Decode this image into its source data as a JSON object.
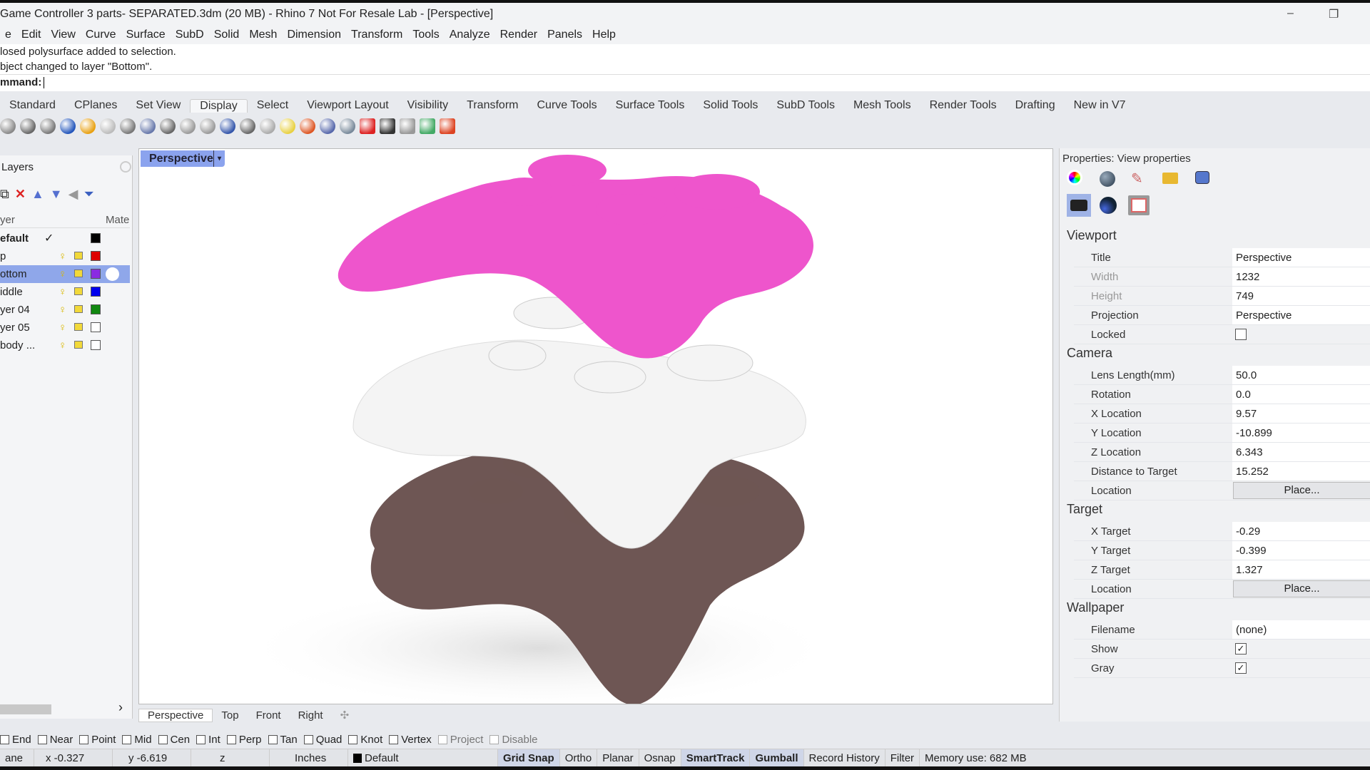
{
  "window": {
    "title": "Game Controller 3 parts- SEPARATED.3dm (20 MB) - Rhino 7 Not For Resale Lab - [Perspective]",
    "minimize": "–",
    "restore": "❐"
  },
  "menu": [
    "e",
    "Edit",
    "View",
    "Curve",
    "Surface",
    "SubD",
    "Solid",
    "Mesh",
    "Dimension",
    "Transform",
    "Tools",
    "Analyze",
    "Render",
    "Panels",
    "Help"
  ],
  "command": {
    "history": [
      "losed polysurface added to selection.",
      "bject changed to layer \"Bottom\"."
    ],
    "prompt": "mmand:",
    "value": ""
  },
  "toolbar_tabs": {
    "items": [
      "Standard",
      "CPlanes",
      "Set View",
      "Display",
      "Select",
      "Viewport Layout",
      "Visibility",
      "Transform",
      "Curve Tools",
      "Surface Tools",
      "Solid Tools",
      "SubD Tools",
      "Mesh Tools",
      "Render Tools",
      "Drafting",
      "New in V7"
    ],
    "active": "Display"
  },
  "layers": {
    "title": "Layers",
    "col_layer": "yer",
    "col_material": "Mate",
    "rows": [
      {
        "name": "efault",
        "current": true,
        "color": "#000000"
      },
      {
        "name": "p",
        "color": "#dd0000"
      },
      {
        "name": "ottom",
        "selected": true,
        "color": "#8a2be2"
      },
      {
        "name": "iddle",
        "color": "#0000ee"
      },
      {
        "name": "yer 04",
        "color": "#118811"
      },
      {
        "name": "yer 05",
        "color": "#ffffff"
      },
      {
        "name": "body ...",
        "color": "#ffffff"
      }
    ],
    "current_mark": "✓",
    "scroll_right": "›"
  },
  "viewport": {
    "title": "Perspective",
    "dropdown": "▾",
    "colors": {
      "top": "#ee55cc",
      "middle": "#f4f4f4",
      "bottom": "#6e5654"
    }
  },
  "viewport_tabs": {
    "items": [
      "Perspective",
      "Top",
      "Front",
      "Right"
    ],
    "active": "Perspective",
    "add": "✣"
  },
  "properties": {
    "title": "Properties: View properties",
    "sections": [
      {
        "name": "Viewport",
        "rows": [
          {
            "label": "Title",
            "value": "Perspective"
          },
          {
            "label": "Width",
            "value": "1232",
            "dim": true
          },
          {
            "label": "Height",
            "value": "749",
            "dim": true
          },
          {
            "label": "Projection",
            "value": "Perspective"
          },
          {
            "label": "Locked",
            "checkbox": false
          }
        ]
      },
      {
        "name": "Camera",
        "rows": [
          {
            "label": "Lens Length(mm)",
            "value": "50.0"
          },
          {
            "label": "Rotation",
            "value": "0.0"
          },
          {
            "label": "X Location",
            "value": "9.57"
          },
          {
            "label": "Y Location",
            "value": "-10.899"
          },
          {
            "label": "Z Location",
            "value": "6.343"
          },
          {
            "label": "Distance to Target",
            "value": "15.252"
          },
          {
            "label": "Location",
            "button": "Place..."
          }
        ]
      },
      {
        "name": "Target",
        "rows": [
          {
            "label": "X Target",
            "value": "-0.29"
          },
          {
            "label": "Y Target",
            "value": "-0.399"
          },
          {
            "label": "Z Target",
            "value": "1.327"
          },
          {
            "label": "Location",
            "button": "Place..."
          }
        ]
      },
      {
        "name": "Wallpaper",
        "rows": [
          {
            "label": "Filename",
            "value": "(none)"
          },
          {
            "label": "Show",
            "checkbox": true
          },
          {
            "label": "Gray",
            "checkbox": true
          }
        ]
      }
    ]
  },
  "osnap": [
    {
      "label": "End",
      "checked": false
    },
    {
      "label": "Near"
    },
    {
      "label": "Point"
    },
    {
      "label": "Mid"
    },
    {
      "label": "Cen"
    },
    {
      "label": "Int"
    },
    {
      "label": "Perp"
    },
    {
      "label": "Tan"
    },
    {
      "label": "Quad"
    },
    {
      "label": "Knot"
    },
    {
      "label": "Vertex"
    },
    {
      "label": "Project",
      "disabled": true
    },
    {
      "label": "Disable",
      "disabled": true
    }
  ],
  "status": {
    "cplane": "ane",
    "x": "x -0.327",
    "y": "y -6.619",
    "z": "z",
    "units": "Inches",
    "layer": "Default",
    "toggles": [
      {
        "label": "Grid Snap",
        "on": true
      },
      {
        "label": "Ortho"
      },
      {
        "label": "Planar"
      },
      {
        "label": "Osnap"
      },
      {
        "label": "SmartTrack",
        "on": true
      },
      {
        "label": "Gumball",
        "on": true
      },
      {
        "label": "Record History"
      },
      {
        "label": "Filter"
      }
    ],
    "memory": "Memory use: 682 MB"
  }
}
